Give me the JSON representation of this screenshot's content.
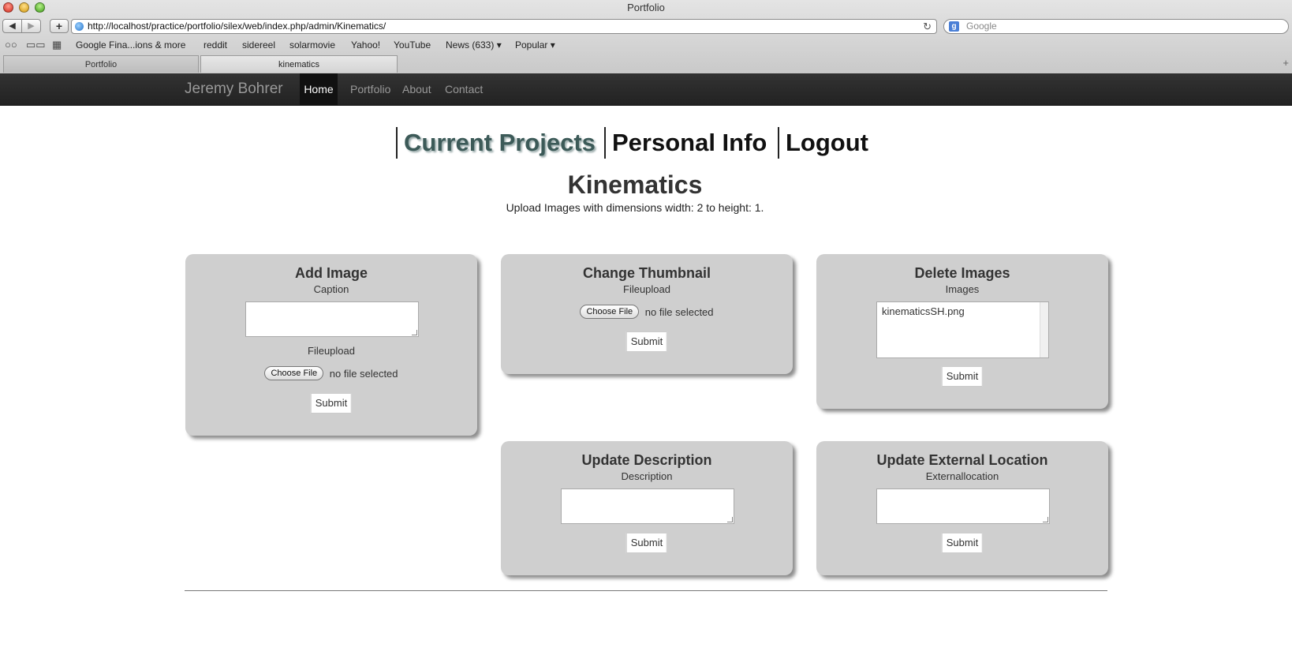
{
  "window": {
    "title": "Portfolio"
  },
  "toolbar": {
    "back_glyph": "◀",
    "forward_glyph": "▶",
    "add_glyph": "+",
    "url": "http://localhost/practice/portfolio/silex/web/index.php/admin/Kinematics/",
    "reload_glyph": "↻",
    "search_placeholder": "Google",
    "search_engine_glyph": "g"
  },
  "bookmarks": {
    "reading_list_glyph": "○○",
    "book_glyph": "▭▭",
    "top_sites_glyph": "▦",
    "items": [
      "Google Fina...ions & more",
      "reddit",
      "sidereel",
      "solarmovie",
      "Yahoo!",
      "YouTube",
      "News (633) ▾",
      "Popular ▾"
    ]
  },
  "tabs": [
    {
      "label": "Portfolio",
      "active": false
    },
    {
      "label": "kinematics",
      "active": true
    }
  ],
  "tabs_new_glyph": "+",
  "site": {
    "brand": "Jeremy Bohrer",
    "nav": [
      "Home",
      "Portfolio",
      "About",
      "Contact"
    ],
    "active_nav": "Home"
  },
  "sections": {
    "current_projects": "Current Projects",
    "personal_info": "Personal Info",
    "logout": "Logout"
  },
  "page": {
    "title": "Kinematics",
    "subtitle": "Upload Images with dimensions width: 2 to height: 1."
  },
  "forms": {
    "add_image": {
      "title": "Add Image",
      "caption_label": "Caption",
      "caption_value": "",
      "file_label": "Fileupload",
      "choose_file": "Choose File",
      "no_file": "no file selected",
      "submit": "Submit"
    },
    "change_thumbnail": {
      "title": "Change Thumbnail",
      "file_label": "Fileupload",
      "choose_file": "Choose File",
      "no_file": "no file selected",
      "submit": "Submit"
    },
    "delete_images": {
      "title": "Delete Images",
      "images_label": "Images",
      "images": [
        "kinematicsSH.png"
      ],
      "submit": "Submit"
    },
    "update_description": {
      "title": "Update Description",
      "description_label": "Description",
      "description_value": "",
      "submit": "Submit"
    },
    "update_external_location": {
      "title": "Update External Location",
      "location_label": "Externallocation",
      "location_value": "",
      "submit": "Submit"
    }
  },
  "colors": {
    "navbar": "#222222",
    "panel": "#cfcfcf",
    "current_section": "#3c5a58"
  }
}
